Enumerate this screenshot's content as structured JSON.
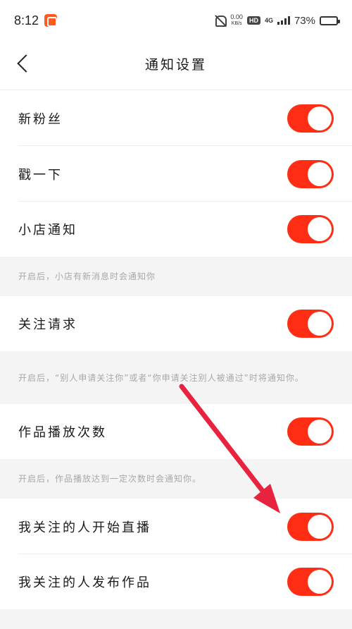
{
  "status_bar": {
    "time": "8:12",
    "net_speed_value": "0.00",
    "net_speed_unit": "KB/s",
    "hd_label": "HD",
    "network_type": "4G",
    "battery_percent": "73%",
    "battery_level": 0.73
  },
  "header": {
    "title": "通知设置"
  },
  "settings": [
    {
      "label": "新粉丝",
      "enabled": true
    },
    {
      "label": "戳一下",
      "enabled": true
    },
    {
      "label": "小店通知",
      "enabled": true,
      "note": "开启后，小店有新消息时会通知你"
    },
    {
      "label": "关注请求",
      "enabled": true,
      "note": "开启后，“别人申请关注你”或者“你申请关注别人被通过”时将通知你。"
    },
    {
      "label": "作品播放次数",
      "enabled": true,
      "note": "开启后，作品播放达到一定次数时会通知你。"
    },
    {
      "label": "我关注的人开始直播",
      "enabled": true
    },
    {
      "label": "我关注的人发布作品",
      "enabled": true
    }
  ],
  "colors": {
    "toggle_on": "#ff2d14",
    "annotation_arrow": "#e8233f"
  }
}
